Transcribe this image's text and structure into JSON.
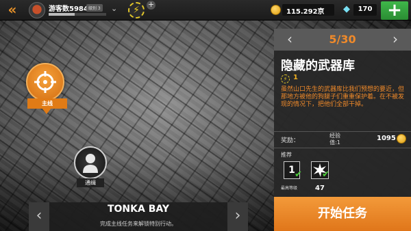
{
  "topbar": {
    "back_icon": "double-chevron-left-icon",
    "player": {
      "name": "游客数5984",
      "level": "级别 3",
      "xp_fraction": 0.45
    },
    "energy_icon": "lightning-icon",
    "energy_plus": "+",
    "cash": {
      "value": "115.292京",
      "icon": "coin-icon"
    },
    "gems": {
      "value": "170",
      "icon": "diamond-icon"
    },
    "add_label": "+"
  },
  "map": {
    "main_marker": {
      "label": "主线",
      "icon": "crosshair-icon"
    },
    "wanted_marker": {
      "label": "通缉",
      "icon": "person-silhouette-icon"
    }
  },
  "area": {
    "name": "TONKA BAY",
    "hint": "完成主线任务来解锁特别行动。"
  },
  "mission": {
    "index": "5/30",
    "title": "隐藏的武器库",
    "difficulty": "1",
    "description": "虽然山口先生的武器库比我们预想的要近，但那地方被他的狗腿子们重重保护着。在不被发现的情况下，把他们全部干掉。",
    "reward_label": "奖励：",
    "xp_label": "经验值:1",
    "reward_cash": "1095",
    "recommend_label": "推荐",
    "recommend_level": "1",
    "recommend_level_caption": "最高等级",
    "recommend_weapon_value": "47",
    "start_label": "开始任务"
  },
  "colors": {
    "accent": "#f08a2a",
    "green": "#3fb74a",
    "gem": "#79e0f4"
  }
}
